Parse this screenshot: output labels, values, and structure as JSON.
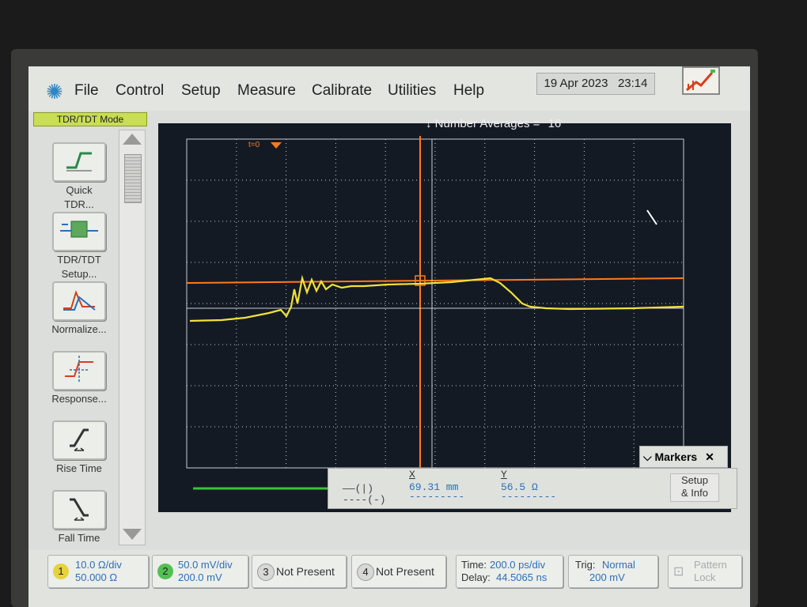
{
  "menubar": {
    "items": [
      "File",
      "Control",
      "Setup",
      "Measure",
      "Calibrate",
      "Utilities",
      "Help"
    ],
    "date": "19 Apr 2023",
    "time": "23:14"
  },
  "mode_tab": "TDR/TDT Mode",
  "sidebar": {
    "buttons": [
      {
        "line1": "Quick",
        "line2": "TDR..."
      },
      {
        "line1": "TDR/TDT",
        "line2": "Setup..."
      },
      {
        "line1": "Normalize...",
        "line2": ""
      },
      {
        "line1": "Response...",
        "line2": ""
      },
      {
        "line1": "Rise Time",
        "line2": ""
      },
      {
        "line1": "Fall Time",
        "line2": ""
      }
    ]
  },
  "plot": {
    "averages_label": "Number Averages =",
    "averages_value": "16",
    "t0_label": "t=0",
    "colors": {
      "trace": "#f2e23a",
      "marker": "#ff7a1a",
      "grid": "#c8ccd4",
      "bg": "#141a24",
      "ch2_line": "#3fbf3f"
    }
  },
  "markers": {
    "title": "Markers",
    "x_header": "X",
    "y_header": "Y",
    "x_value": "69.31 mm",
    "y_value": "56.5 Ω",
    "row1_sym": "——(|)",
    "row2_sym": "----(-)",
    "setup_line1": "Setup",
    "setup_line2": "& Info"
  },
  "status": {
    "ch1_num": "1",
    "ch1_scale": "10.0 Ω/div",
    "ch1_offset": "50.000 Ω",
    "ch2_num": "2",
    "ch2_scale": "50.0 mV/div",
    "ch2_offset": "200.0 mV",
    "ch3_num": "3",
    "ch3_label": "Not Present",
    "ch4_num": "4",
    "ch4_label": "Not Present",
    "time_label": "Time:",
    "time_value": "200.0 ps/div",
    "delay_label": "Delay:",
    "delay_value": "44.5065 ns",
    "trig_label": "Trig:",
    "trig_mode": "Normal",
    "trig_level": "200 mV",
    "pattern_line1": "Pattern",
    "pattern_line2": "Lock"
  }
}
